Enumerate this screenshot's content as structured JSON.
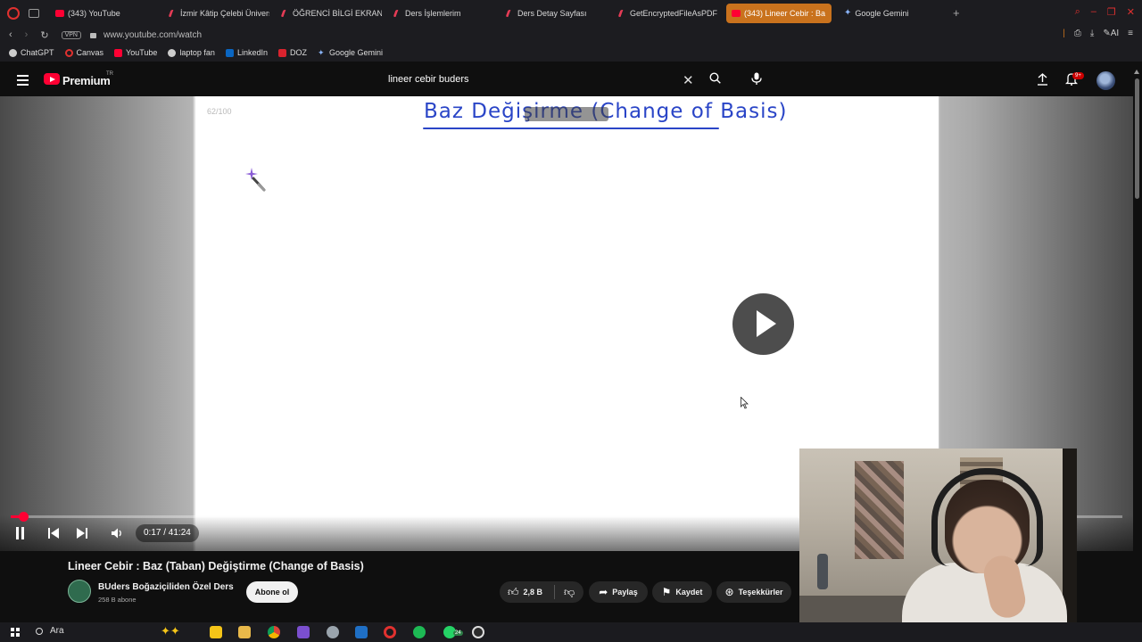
{
  "browser": {
    "tabs": [
      {
        "label": "(343) YouTube",
        "icon": "youtube-icon",
        "active": false
      },
      {
        "label": "İzmir Kâtip Çelebi Üniversi",
        "icon": "pen-icon",
        "active": false
      },
      {
        "label": "ÖĞRENCİ BİLGİ EKRANI*",
        "icon": "pen-icon",
        "active": false
      },
      {
        "label": "Ders İşlemlerim",
        "icon": "pen-icon",
        "active": false
      },
      {
        "label": "Ders Detay Sayfası",
        "icon": "pen-icon",
        "active": false
      },
      {
        "label": "GetEncryptedFileAsPDF",
        "icon": "pen-icon",
        "active": false
      },
      {
        "label": "(343) Lineer Cebir : Ba",
        "icon": "youtube-icon",
        "active": true
      },
      {
        "label": "Google Gemini",
        "icon": "gemini-icon",
        "active": false
      }
    ],
    "vpn_label": "VPN",
    "url": "www.youtube.com/watch",
    "ai_label": "AI",
    "bookmarks": [
      {
        "label": "ChatGPT",
        "icon": "chatgpt-icon"
      },
      {
        "label": "Canvas",
        "icon": "canvas-icon"
      },
      {
        "label": "YouTube",
        "icon": "youtube-icon"
      },
      {
        "label": "laptop fan",
        "icon": "bookmark-icon"
      },
      {
        "label": "LinkedIn",
        "icon": "linkedin-icon"
      },
      {
        "label": "DOZ",
        "icon": "doz-icon"
      },
      {
        "label": "Google Gemini",
        "icon": "gemini-icon"
      }
    ]
  },
  "youtube": {
    "brand": "Premium",
    "region": "TR",
    "search_query": "lineer cebir buders",
    "notification_count": "9+",
    "player": {
      "slide_counter": "62/100",
      "board_title": "Baz Değişirme (Change of Basis)",
      "time_current": "0:17",
      "time_total": "41:24",
      "time_display": "0:17 / 41:24",
      "progress_fraction": 0.007,
      "state": "paused"
    },
    "video_title": "Lineer Cebir : Baz (Taban) Değiştirme (Change of Basis)",
    "channel": {
      "name": "BUders Boğaziçiliden Özel Ders",
      "subscribers": "258 B abone",
      "subscribe_label": "Abone ol"
    },
    "actions": {
      "like_count": "2,8 B",
      "share_label": "Paylaş",
      "save_label": "Kaydet",
      "thanks_label": "Teşekkürler"
    }
  },
  "taskbar": {
    "search_label": "Ara",
    "apps": [
      "copilot-icon",
      "sticky-notes-icon",
      "file-explorer-icon",
      "chrome-icon",
      "visual-studio-icon",
      "app-icon",
      "terminal-icon",
      "opera-icon",
      "spotify-icon",
      "whatsapp-icon",
      "obs-icon"
    ],
    "whatsapp_badge": "24"
  },
  "colors": {
    "youtube_red": "#ff0033",
    "active_tab": "#c9721d",
    "board_ink": "#2a45c7"
  }
}
